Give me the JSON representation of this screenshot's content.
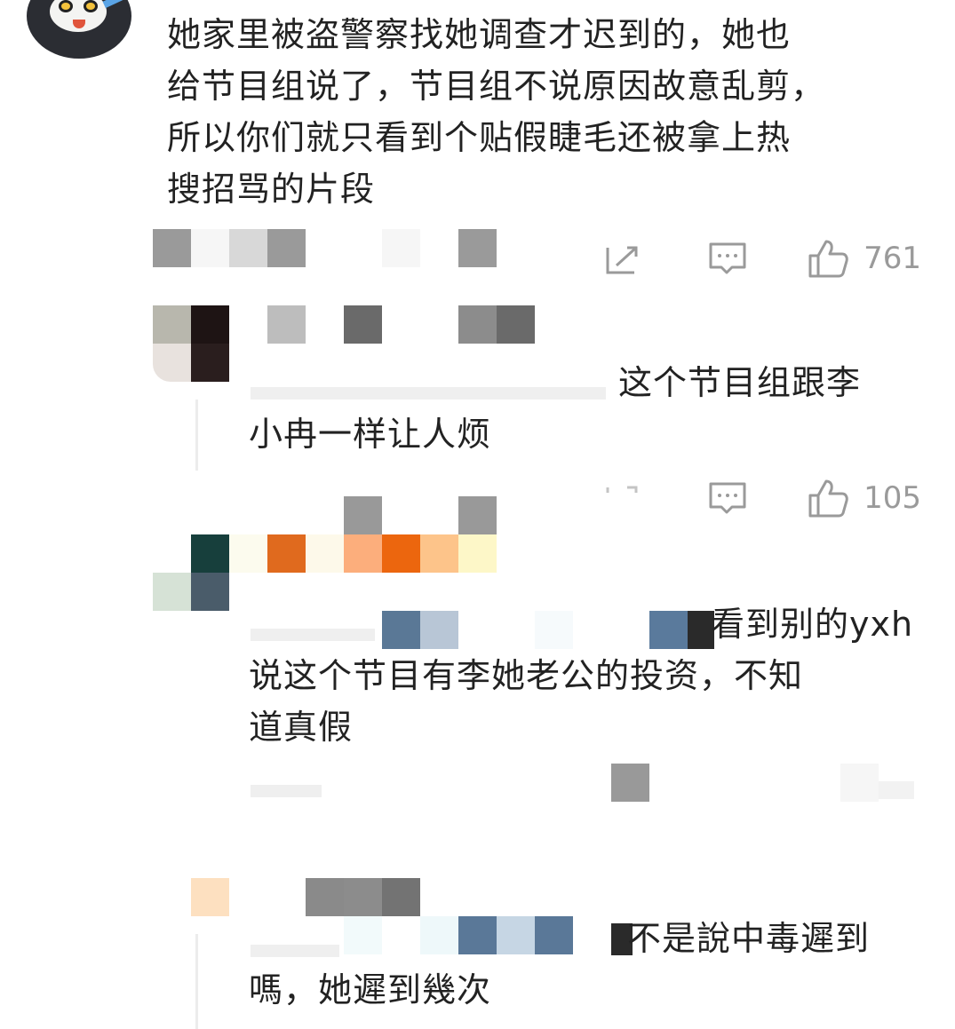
{
  "comment": {
    "lines": [
      "她家里被盗警察找她调查才迟到的，她也",
      "给节目组说了，节目组不说原因故意乱剪，",
      "所以你们就只看到个贴假睫毛还被拿上热",
      "搜招骂的片段"
    ],
    "like_count": "761"
  },
  "replies": [
    {
      "lines": [
        "这个节目组跟李",
        "小冉一样让人烦"
      ],
      "like_count": "105"
    },
    {
      "lines": [
        "看到别的yxh",
        "说这个节目有李她老公的投资，不知",
        "道真假"
      ]
    },
    {
      "lines": [
        "不是說中毒遲到",
        "嗎，她遲到幾次"
      ]
    }
  ],
  "icons": {
    "forward": "forward-icon",
    "comment": "comment-icon",
    "like": "thumbs-up-icon"
  },
  "colors": {
    "text": "#222222",
    "meta": "#9a9a9a",
    "background": "#ffffff"
  }
}
